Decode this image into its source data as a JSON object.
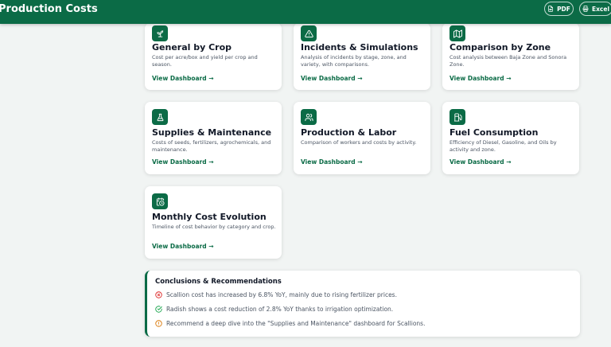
{
  "header": {
    "title": "Production Costs",
    "pdf_label": "PDF",
    "excel_label": "Excel"
  },
  "cards": [
    {
      "icon": "sprout-icon",
      "title": "General by Crop",
      "description": "Cost per acre/box and yield per crop and season.",
      "link": "View Dashboard →"
    },
    {
      "icon": "warning-triangle-icon",
      "title": "Incidents & Simulations",
      "description": "Analysis of incidents by stage, zone, and variety, with comparisons.",
      "link": "View Dashboard →"
    },
    {
      "icon": "map-icon",
      "title": "Comparison by Zone",
      "description": "Cost analysis between Baja Zone and Sonora Zone.",
      "link": "View Dashboard →"
    },
    {
      "icon": "flask-icon",
      "title": "Supplies & Maintenance",
      "description": "Costs of seeds, fertilizers, agrochemicals, and maintenance.",
      "link": "View Dashboard →"
    },
    {
      "icon": "users-icon",
      "title": "Production & Labor",
      "description": "Comparison of workers and costs by activity.",
      "link": "View Dashboard →"
    },
    {
      "icon": "fuel-pump-icon",
      "title": "Fuel Consumption",
      "description": "Efficiency of Diesel, Gasoline, and Oils by activity and zone.",
      "link": "View Dashboard →"
    },
    {
      "icon": "calendar-clock-icon",
      "title": "Monthly Cost Evolution",
      "description": "Timeline of cost behavior by category and crop.",
      "link": "View Dashboard →"
    }
  ],
  "conclusions": {
    "title": "Conclusions & Recommendations",
    "items": [
      {
        "icon": "x-circle-icon",
        "color": "#dc2626",
        "text": "Scallion cost has increased by 6.8% YoY, mainly due to rising fertilizer prices."
      },
      {
        "icon": "check-circle-icon",
        "color": "#16a34a",
        "text": "Radish shows a cost reduction of 2.8% YoY thanks to irrigation optimization."
      },
      {
        "icon": "alert-circle-icon",
        "color": "#d97706",
        "text": "Recommend a deep dive into the \"Supplies and Maintenance\" dashboard for Scallions."
      }
    ]
  },
  "colors": {
    "brand": "#0b6b46",
    "background": "#f1f4f3"
  }
}
